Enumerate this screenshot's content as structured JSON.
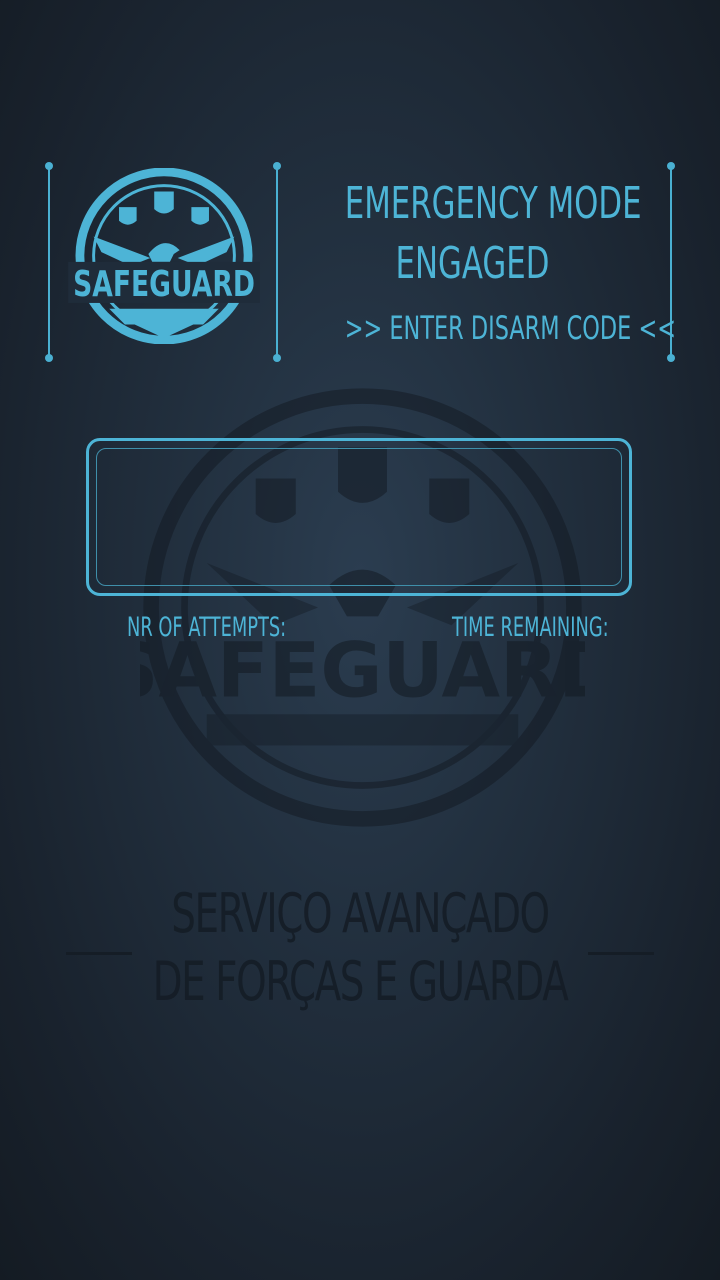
{
  "header": {
    "title_line1": "EMERGENCY MODE",
    "title_line2": "ENGAGED",
    "subtitle": ">>  ENTER DISARM CODE <<"
  },
  "logo": {
    "text": "SAFEGUARD"
  },
  "code_input": {
    "value": ""
  },
  "stats": {
    "attempts_label": "NR OF ATTEMPTS:",
    "time_label": "TIME REMAINING:"
  },
  "background": {
    "watermark_logo_text": "SAFEGUARD",
    "watermark_title": "SERVIÇO AVANÇADO\nDE FORÇAS E GUARDA"
  },
  "colors": {
    "accent": "#4db4d6",
    "background": "#1e2a37"
  }
}
